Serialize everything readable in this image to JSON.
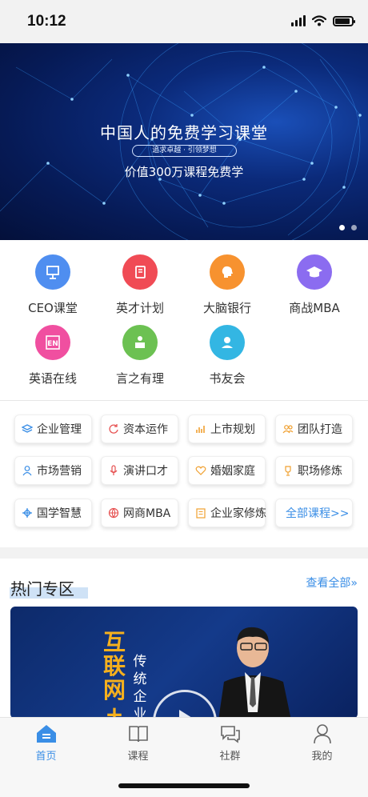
{
  "status_bar": {
    "time": "10:12"
  },
  "banner": {
    "title": "中国人的免费学习课堂",
    "pill": "追求卓越 · 引领梦想",
    "subtitle": "价值300万课程免费学",
    "page_count": 2,
    "active_page": 1
  },
  "categories": [
    {
      "label": "CEO课堂",
      "icon": "presentation-board-icon",
      "color": "#4f8ef0"
    },
    {
      "label": "英才计划",
      "icon": "book-icon",
      "color": "#f04b55"
    },
    {
      "label": "大脑银行",
      "icon": "brain-head-icon",
      "color": "#f7922f"
    },
    {
      "label": "商战MBA",
      "icon": "graduation-cap-icon",
      "color": "#8b6cf0"
    },
    {
      "label": "英语在线",
      "icon": "en-icon",
      "color": "#f04fa0"
    },
    {
      "label": "言之有理",
      "icon": "speaker-podium-icon",
      "color": "#6cc152"
    },
    {
      "label": "书友会",
      "icon": "reading-group-icon",
      "color": "#33b6e3"
    }
  ],
  "chips": [
    {
      "label": "企业管理",
      "icon": "layers-icon",
      "color": "#3a8ee6"
    },
    {
      "label": "资本运作",
      "icon": "refresh-icon",
      "color": "#e65050"
    },
    {
      "label": "上市规划",
      "icon": "bar-chart-icon",
      "color": "#f0a030"
    },
    {
      "label": "团队打造",
      "icon": "team-icon",
      "color": "#f0a030"
    },
    {
      "label": "市场营销",
      "icon": "user-icon",
      "color": "#3a8ee6"
    },
    {
      "label": "演讲口才",
      "icon": "microphone-icon",
      "color": "#e65050"
    },
    {
      "label": "婚姻家庭",
      "icon": "heart-icon",
      "color": "#f0a030"
    },
    {
      "label": "职场修炼",
      "icon": "trophy-icon",
      "color": "#f0a030"
    },
    {
      "label": "国学智慧",
      "icon": "knot-icon",
      "color": "#3a8ee6"
    },
    {
      "label": "网商MBA",
      "icon": "globe-icon",
      "color": "#e65050"
    },
    {
      "label": "企业家修炼",
      "icon": "document-icon",
      "color": "#f0a030"
    },
    {
      "label": "全部课程>>",
      "icon": "",
      "color": "#3a8ee6"
    }
  ],
  "hot": {
    "title": "热门专区",
    "see_all": "查看全部»",
    "card_text_yellow": "互联网+",
    "card_text_white": "传统企业"
  },
  "tabbar": [
    {
      "label": "首页",
      "icon": "home-icon",
      "active": true
    },
    {
      "label": "课程",
      "icon": "open-book-icon",
      "active": false
    },
    {
      "label": "社群",
      "icon": "chat-bubbles-icon",
      "active": false
    },
    {
      "label": "我的",
      "icon": "profile-icon",
      "active": false
    }
  ],
  "colors": {
    "accent": "#3a8ee6"
  }
}
